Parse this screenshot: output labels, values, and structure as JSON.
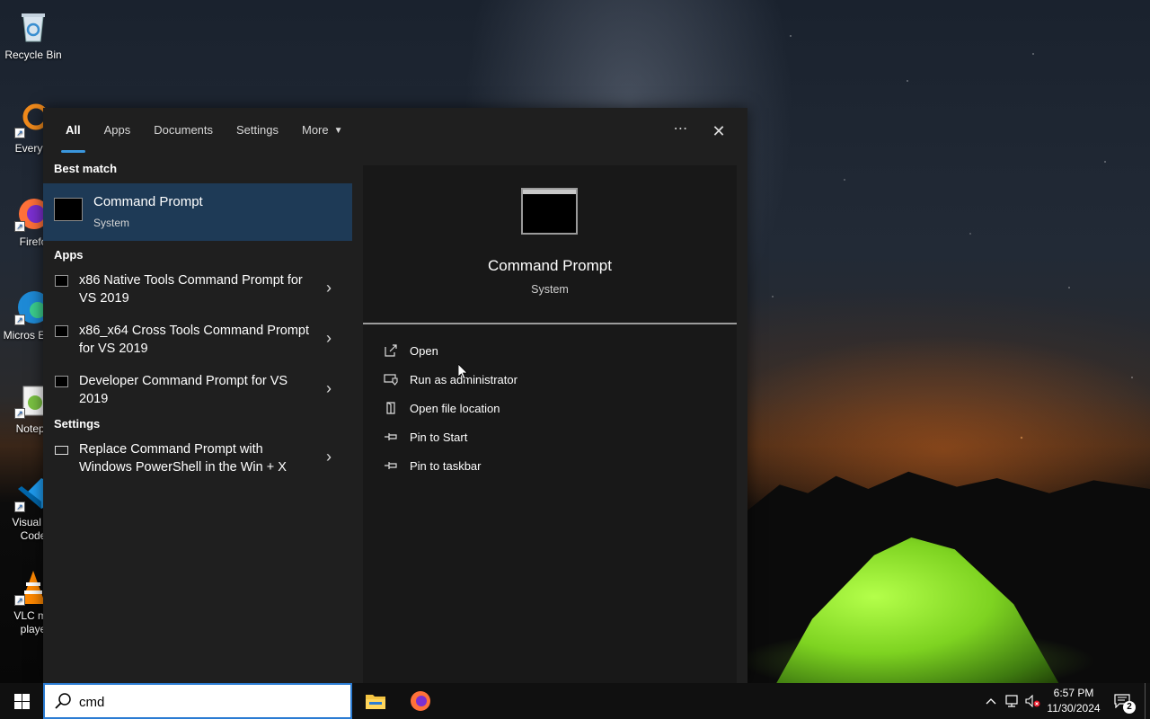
{
  "desktop": {
    "icons": [
      {
        "label": "Recycle Bin",
        "icon": "recycle-bin-icon"
      },
      {
        "label": "Everyth",
        "icon": "everything-search-icon"
      },
      {
        "label": "Firefo",
        "icon": "firefox-icon"
      },
      {
        "label": "Micros Edge",
        "icon": "edge-icon"
      },
      {
        "label": "Notepa",
        "icon": "notepad-plus-plus-icon"
      },
      {
        "label": "Visual St Code",
        "icon": "vscode-icon"
      },
      {
        "label": "VLC me playe",
        "icon": "vlc-icon"
      }
    ]
  },
  "search_panel": {
    "tabs": [
      {
        "label": "All",
        "active": true
      },
      {
        "label": "Apps",
        "active": false
      },
      {
        "label": "Documents",
        "active": false
      },
      {
        "label": "Settings",
        "active": false
      },
      {
        "label": "More",
        "active": false
      }
    ],
    "more_glyph": "⋯",
    "close_glyph": "✕",
    "best_match": {
      "heading": "Best match",
      "title": "Command Prompt",
      "subtitle": "System"
    },
    "apps_section": {
      "heading": "Apps",
      "items": [
        {
          "label": "x86 Native Tools Command Prompt for VS 2019"
        },
        {
          "label": "x86_x64 Cross Tools Command Prompt for VS 2019"
        },
        {
          "label": "Developer Command Prompt for VS 2019"
        }
      ]
    },
    "settings_section": {
      "heading": "Settings",
      "items": [
        {
          "label": "Replace Command Prompt with Windows PowerShell in the Win + X"
        }
      ]
    },
    "preview": {
      "title": "Command Prompt",
      "subtitle": "System",
      "actions": [
        {
          "label": "Open",
          "icon": "open-external-icon"
        },
        {
          "label": "Run as administrator",
          "icon": "admin-shield-icon"
        },
        {
          "label": "Open file location",
          "icon": "file-location-icon"
        },
        {
          "label": "Pin to Start",
          "icon": "pin-icon"
        },
        {
          "label": "Pin to taskbar",
          "icon": "pin-icon"
        }
      ]
    }
  },
  "taskbar": {
    "search_value": "cmd",
    "tray": {
      "time": "6:57 PM",
      "date": "11/30/2024",
      "notification_count": "2"
    }
  },
  "colors": {
    "accent": "#3a96dd",
    "best_match_bg": "#1e3a56",
    "panel_bg": "#1f1f1f"
  }
}
